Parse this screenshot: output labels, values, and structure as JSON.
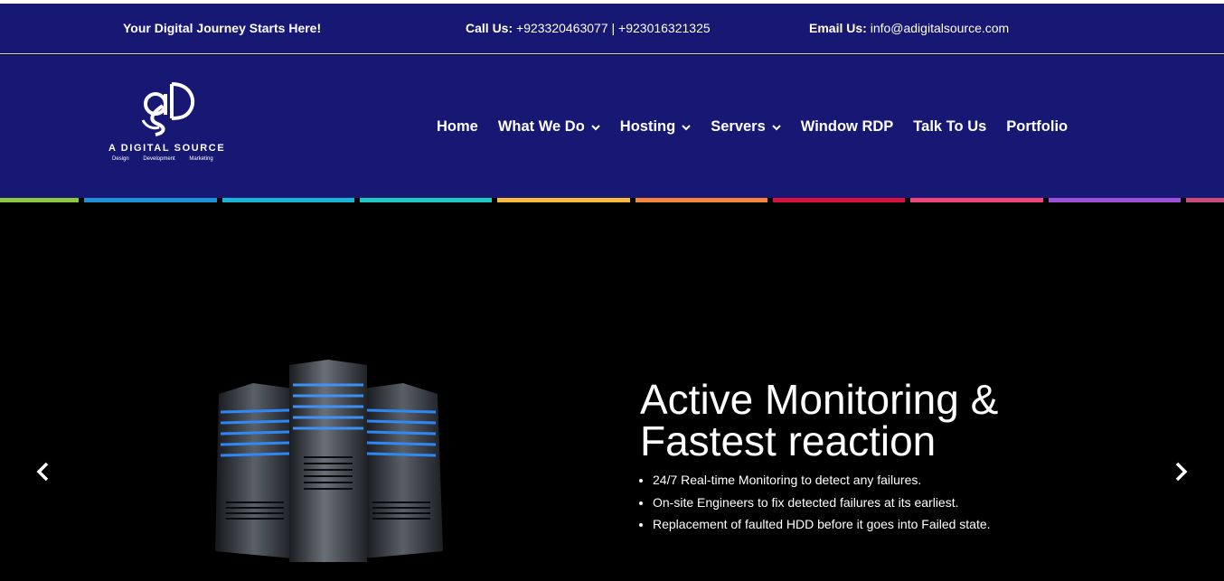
{
  "topbar": {
    "tagline": "Your Digital Journey Starts Here!",
    "call_label": "Call Us:",
    "call_value": " +923320463077 | +923016321325",
    "email_label": "Email Us:",
    "email_value": " info@adigitalsource.com"
  },
  "logo": {
    "brand": "A DIGITAL SOURCE",
    "tagline": "Design Development Marketing",
    "icon": "ads-monogram-icon"
  },
  "nav": {
    "items": [
      {
        "label": "Home",
        "dropdown": false
      },
      {
        "label": "What We Do",
        "dropdown": true
      },
      {
        "label": "Hosting",
        "dropdown": true
      },
      {
        "label": "Servers",
        "dropdown": true
      },
      {
        "label": "Window RDP",
        "dropdown": false
      },
      {
        "label": "Talk To Us",
        "dropdown": false
      },
      {
        "label": "Portfolio",
        "dropdown": false
      }
    ]
  },
  "stripe_colors": [
    "#8dc63f",
    "#1d8fd6",
    "#19b5d8",
    "#1ec7c0",
    "#f9b93a",
    "#f7853a",
    "#d8123f",
    "#f0457b",
    "#9b4fd6",
    "#c94a78"
  ],
  "hero": {
    "heading_line1": "Active Monitoring &",
    "heading_line2": "Fastest reaction",
    "bullets": [
      "24/7 Real-time Monitoring to detect any failures.",
      "On-site Engineers to fix detected failures at its earliest.",
      "Replacement of faulted HDD before it goes into Failed state."
    ],
    "prev_icon": "chevron-left-icon",
    "next_icon": "chevron-right-icon",
    "image_icon": "server-rack-icon"
  },
  "colors": {
    "header_bg": "#171774",
    "hero_bg": "#000000",
    "server_glow": "#2f8cff"
  }
}
